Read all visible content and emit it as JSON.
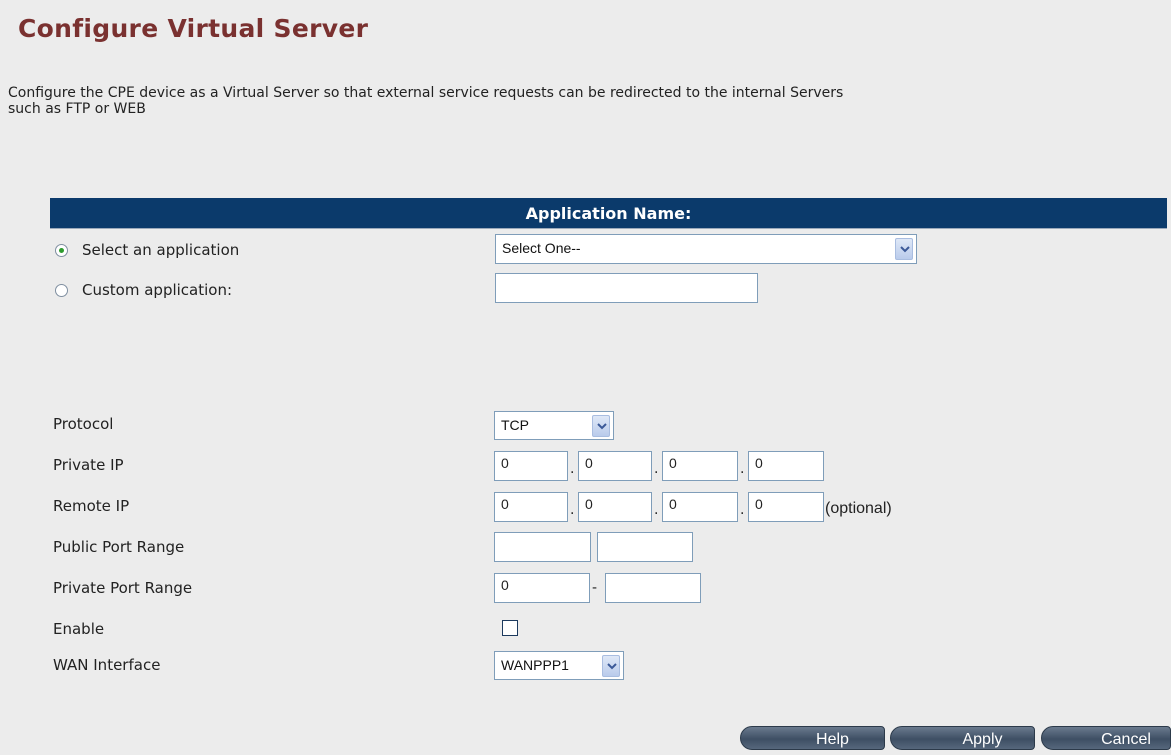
{
  "page": {
    "title": "Configure Virtual Server",
    "description": "Configure the CPE device as a Virtual Server so that external service requests can be redirected to the internal Servers such as FTP or WEB"
  },
  "app_section": {
    "header": "Application Name:",
    "select_radio_label": "Select an application",
    "select_radio_checked": true,
    "select_value": "Select One--",
    "custom_radio_label": "Custom application:",
    "custom_radio_checked": false,
    "custom_value": ""
  },
  "fields": {
    "protocol_label": "Protocol",
    "protocol_value": "TCP",
    "private_ip_label": "Private IP",
    "private_ip": [
      "0",
      "0",
      "0",
      "0"
    ],
    "remote_ip_label": "Remote IP",
    "remote_ip": [
      "0",
      "0",
      "0",
      "0"
    ],
    "remote_ip_note": "(optional)",
    "public_port_label": "Public Port Range",
    "public_port_start": "",
    "public_port_end": "",
    "private_port_label": "Private Port Range",
    "private_port_start": "0",
    "private_port_sep": "-",
    "private_port_end": "",
    "enable_label": "Enable",
    "enable_checked": false,
    "wan_label": "WAN Interface",
    "wan_value": "WANPPP1"
  },
  "buttons": {
    "help": "Help",
    "apply": "Apply",
    "cancel": "Cancel"
  },
  "colors": {
    "title": "#7a3130",
    "header_bar": "#0b3a6b",
    "radio_selected": "#2d9b2d"
  }
}
